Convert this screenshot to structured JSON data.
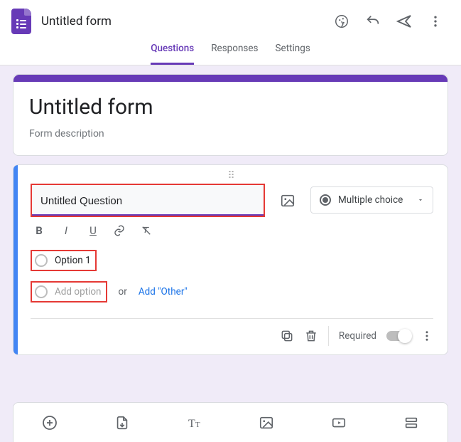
{
  "header": {
    "doc_title": "Untitled form"
  },
  "tabs": {
    "questions": "Questions",
    "responses": "Responses",
    "settings": "Settings"
  },
  "title_card": {
    "title": "Untitled form",
    "description": "Form description"
  },
  "question": {
    "text": "Untitled Question",
    "type_label": "Multiple choice",
    "options": [
      "Option 1"
    ],
    "add_option_label": "Add option",
    "or_label": "or",
    "add_other_label": "Add \"Other\"",
    "required_label": "Required",
    "required_state": false
  },
  "colors": {
    "accent": "#673ab7",
    "highlight": "#e53935",
    "link": "#1a73e8"
  }
}
